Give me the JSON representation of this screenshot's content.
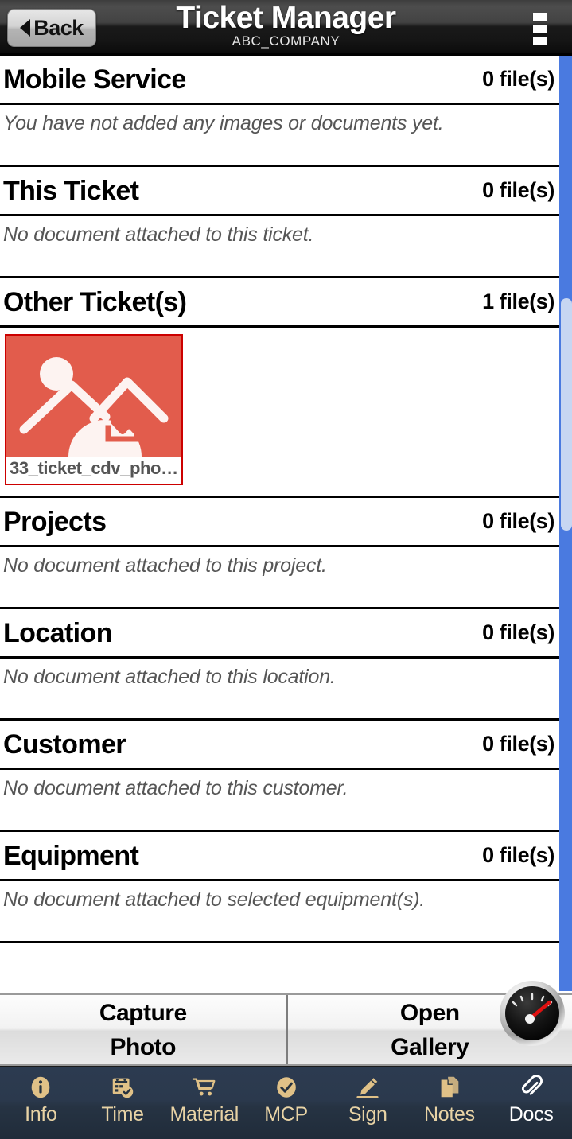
{
  "header": {
    "back_label": "Back",
    "title": "Ticket Manager",
    "subtitle": "ABC_COMPANY",
    "menu_icon": "kebab-menu-icon"
  },
  "sections": [
    {
      "title": "Mobile Service",
      "count": "0 file(s)",
      "message": "You have not added any images or documents yet.",
      "files": []
    },
    {
      "title": "This Ticket",
      "count": "0 file(s)",
      "message": "No document attached to this ticket.",
      "files": []
    },
    {
      "title": "Other Ticket(s)",
      "count": "1 file(s)",
      "message": "",
      "files": [
        {
          "name": "33_ticket_cdv_pho…",
          "thumb_icon": "image-download-icon",
          "thumb_color": "#e25c4c"
        }
      ]
    },
    {
      "title": "Projects",
      "count": "0 file(s)",
      "message": "No document attached to this project.",
      "files": []
    },
    {
      "title": "Location",
      "count": "0 file(s)",
      "message": "No document attached to this location.",
      "files": []
    },
    {
      "title": "Customer",
      "count": "0 file(s)",
      "message": "No document attached to this customer.",
      "files": []
    },
    {
      "title": "Equipment",
      "count": "0 file(s)",
      "message": "No document attached to selected equipment(s).",
      "files": []
    }
  ],
  "actions": [
    {
      "label": "Capture\nPhoto",
      "line1": "Capture",
      "line2": "Photo",
      "name": "capture-photo-button"
    },
    {
      "label": "Open\nGallery",
      "line1": "Open",
      "line2": "Gallery",
      "name": "open-gallery-button"
    }
  ],
  "gauge": {
    "icon": "speedometer-gauge-icon"
  },
  "bottom_nav": [
    {
      "label": "Info",
      "icon": "info-circle-icon",
      "active": false
    },
    {
      "label": "Time",
      "icon": "calendar-check-icon",
      "active": false
    },
    {
      "label": "Material",
      "icon": "shopping-cart-icon",
      "active": false
    },
    {
      "label": "MCP",
      "icon": "check-circle-icon",
      "active": false
    },
    {
      "label": "Sign",
      "icon": "pen-sign-icon",
      "active": false
    },
    {
      "label": "Notes",
      "icon": "documents-icon",
      "active": false
    },
    {
      "label": "Docs",
      "icon": "paperclip-icon",
      "active": true
    }
  ],
  "colors": {
    "scrollbar_track": "#4a7ae0",
    "scrollbar_thumb": "#c7d6f2",
    "nav_background": "#2b394d",
    "nav_icon_tan": "#e0c187",
    "thumb_red": "#e25c4c",
    "file_border": "#cc0000"
  }
}
